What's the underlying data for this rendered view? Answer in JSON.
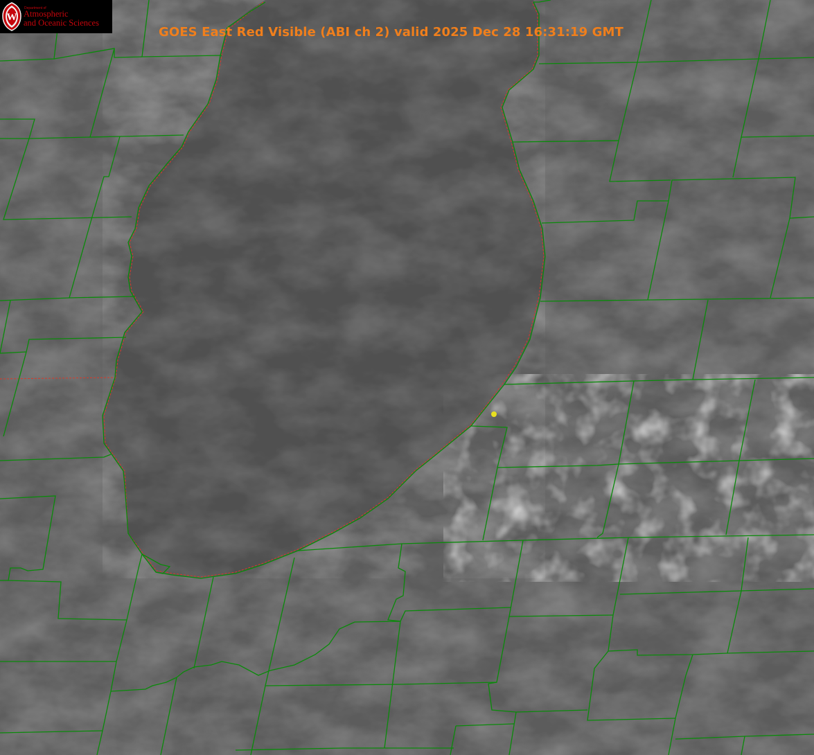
{
  "title": "GOES East Red Visible (ABI ch 2) valid 2025 Dec 28 16:31:19 GMT",
  "logo": {
    "dept": "Department of",
    "line1": "Atmospheric",
    "line2": "and Oceanic Sciences",
    "crest_letter": "W"
  },
  "colors": {
    "title": "#f07f1c",
    "county_lines": "#0a8a0a",
    "state_border": "#d93a2a",
    "marker": "#e8e020",
    "logo_text": "#c5050c",
    "imagery_gray": "#5c5c5c",
    "lake_gray": "#4f4f4f"
  },
  "features": {
    "marker": "yellow-point",
    "lake": "Lake Michigan (southern basin)"
  }
}
